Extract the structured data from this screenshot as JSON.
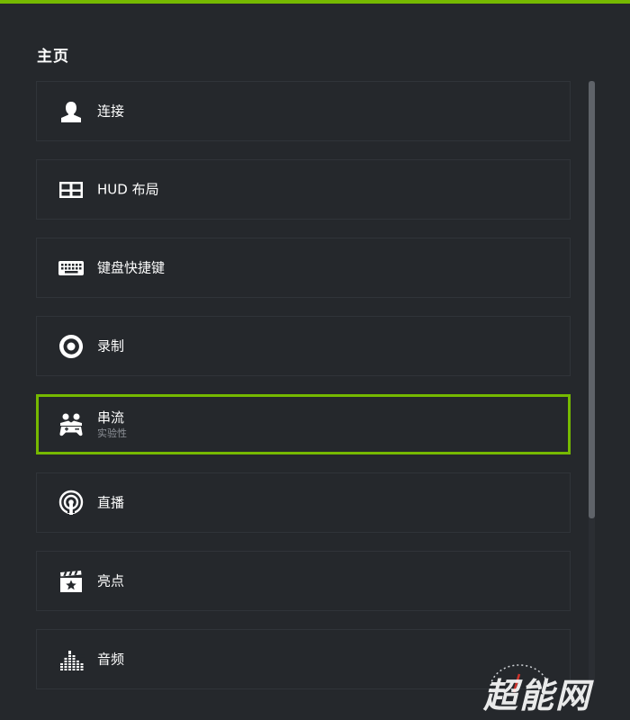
{
  "header": {
    "title": "主页"
  },
  "menu": {
    "items": [
      {
        "label": "连接",
        "icon": "person-icon"
      },
      {
        "label": "HUD 布局",
        "icon": "hud-layout-icon"
      },
      {
        "label": "键盘快捷键",
        "icon": "keyboard-icon"
      },
      {
        "label": "录制",
        "icon": "record-icon"
      },
      {
        "label": "串流",
        "sublabel": "实验性",
        "icon": "gamestream-icon",
        "selected": true
      },
      {
        "label": "直播",
        "icon": "broadcast-icon"
      },
      {
        "label": "亮点",
        "icon": "highlights-icon"
      },
      {
        "label": "音频",
        "icon": "audio-equalizer-icon"
      }
    ]
  },
  "watermark": {
    "text": "超能网"
  },
  "colors": {
    "accent": "#76b900",
    "background": "#25282c",
    "item_border": "#303439",
    "text": "#ffffff",
    "subtext": "#8e9298"
  }
}
